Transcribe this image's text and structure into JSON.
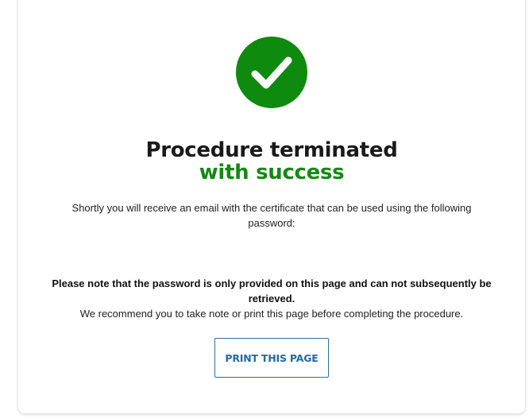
{
  "result": {
    "icon": "check-circle-icon",
    "icon_color": "#0e8a0e",
    "title": "Procedure terminated",
    "subtitle": "with success",
    "subtitle_color": "#138a13",
    "info_text": "Shortly you will receive an email with the certificate that can be used using the following password:",
    "note_bold": "Please note that the password is only provided on this page and can not subsequently be retrieved.",
    "note_plain": "We recommend you to take note or print this page before completing the procedure.",
    "print_button_label": "PRINT THIS PAGE",
    "accent_color": "#1f6aa8"
  }
}
